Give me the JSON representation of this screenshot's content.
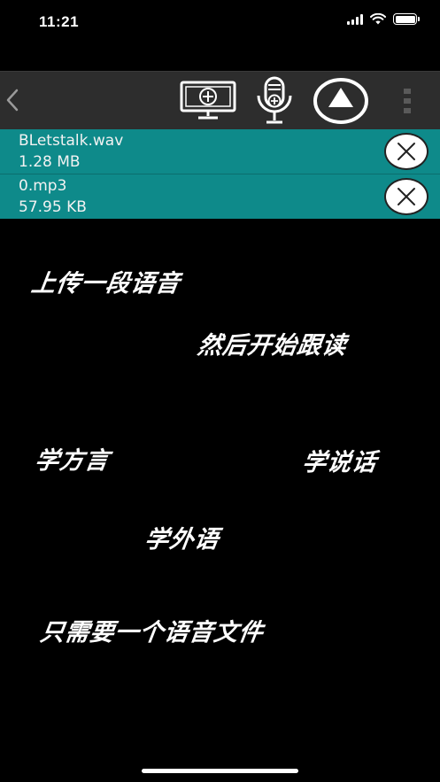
{
  "status_bar": {
    "time": "11:21"
  },
  "files": [
    {
      "name": "BLetstalk.wav",
      "size": "1.28 MB"
    },
    {
      "name": "0.mp3",
      "size": "57.95 KB"
    }
  ],
  "promo": {
    "line1": "上传一段语音",
    "line2": "然后开始跟读",
    "line3": "学方言",
    "line4": "学说话",
    "line5": "学外语",
    "line6": "只需要一个语音文件"
  },
  "colors": {
    "background": "#000000",
    "toolbar": "#2d2d2d",
    "file_row": "#0e8a8a"
  },
  "icons": {
    "back": "chevron-left-icon",
    "screen": "screen-add-icon",
    "mic": "microphone-add-icon",
    "upload": "upload-circle-icon",
    "more": "more-vertical-icon",
    "remove": "close-circle-icon"
  }
}
